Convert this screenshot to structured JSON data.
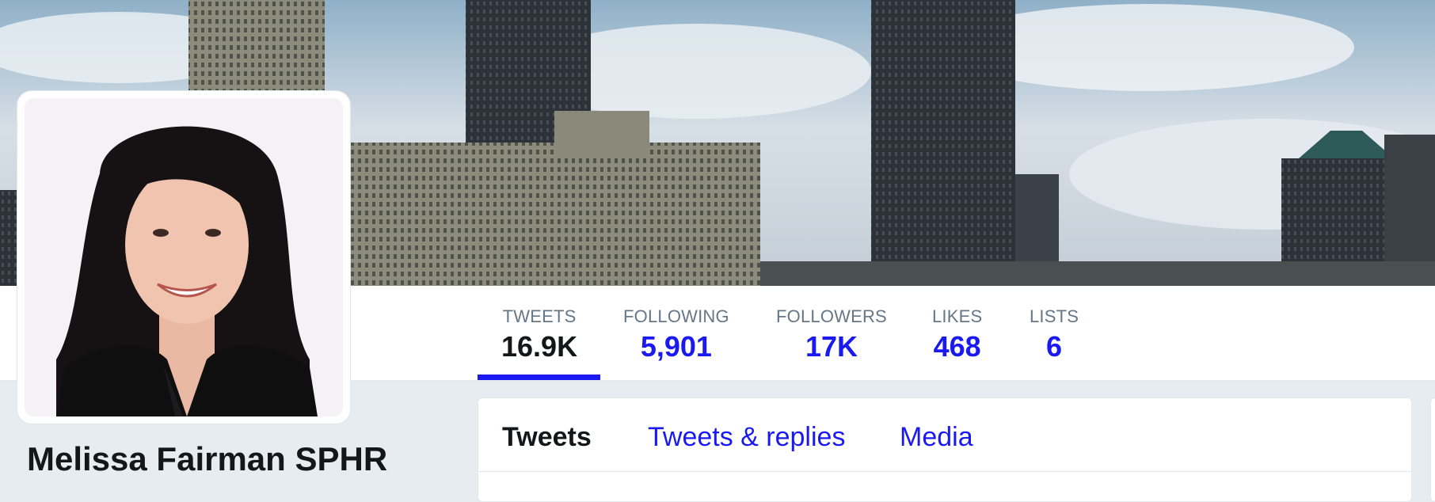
{
  "profile": {
    "name": "Melissa Fairman SPHR"
  },
  "stats": [
    {
      "label": "TWEETS",
      "value": "16.9K",
      "active": true
    },
    {
      "label": "FOLLOWING",
      "value": "5,901",
      "active": false
    },
    {
      "label": "FOLLOWERS",
      "value": "17K",
      "active": false
    },
    {
      "label": "LIKES",
      "value": "468",
      "active": false
    },
    {
      "label": "LISTS",
      "value": "6",
      "active": false
    }
  ],
  "tabs": [
    {
      "label": "Tweets",
      "active": true
    },
    {
      "label": "Tweets & replies",
      "active": false
    },
    {
      "label": "Media",
      "active": false
    }
  ],
  "colors": {
    "link": "#1a1af0",
    "text": "#14171a",
    "muted": "#657786",
    "page_bg": "#e6ecf0"
  },
  "banner": {
    "image": "city-skyline-photo"
  },
  "avatar": {
    "image": "profile-photo"
  }
}
